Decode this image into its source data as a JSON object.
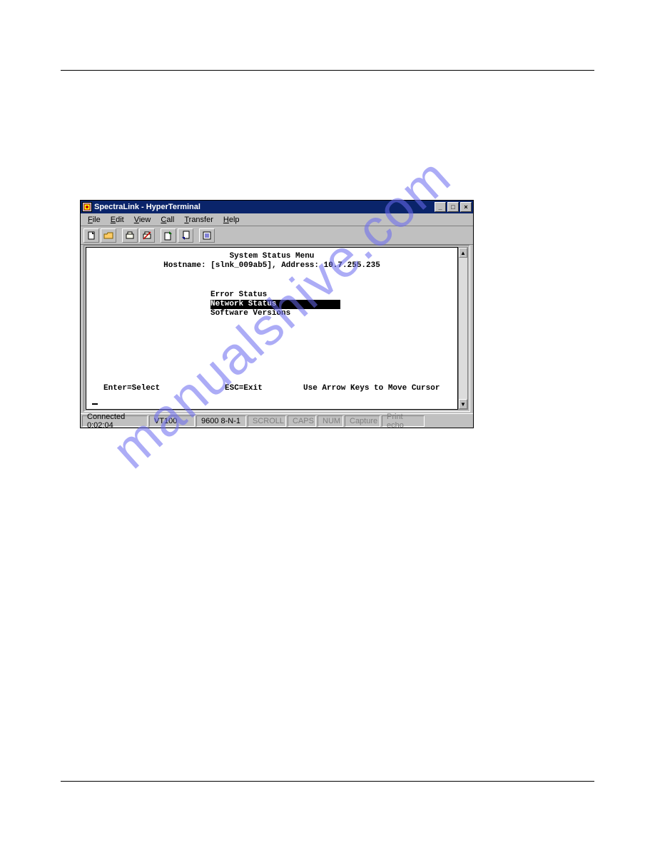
{
  "window": {
    "title": "SpectraLink - HyperTerminal",
    "menus": [
      "File",
      "Edit",
      "View",
      "Call",
      "Transfer",
      "Help"
    ]
  },
  "winbuttons": {
    "min": "_",
    "max": "□",
    "close": "×"
  },
  "terminal": {
    "heading": "System Status Menu",
    "hostline": "Hostname: [slnk_009ab5], Address: 10.7.255.235",
    "items": {
      "error_status": "Error Status",
      "network_status": "Network Status",
      "software_versions": "Software Versions"
    },
    "hints": {
      "enter": "Enter=Select",
      "esc": "ESC=Exit",
      "arrows": "Use Arrow Keys to Move Cursor"
    }
  },
  "status": {
    "connected": "Connected 0:02:04",
    "emulation": "VT100",
    "settings": "9600 8-N-1",
    "scroll": "SCROLL",
    "caps": "CAPS",
    "num": "NUM",
    "capture": "Capture",
    "printecho": "Print echo"
  },
  "scroll": {
    "up": "▲",
    "down": "▼"
  }
}
